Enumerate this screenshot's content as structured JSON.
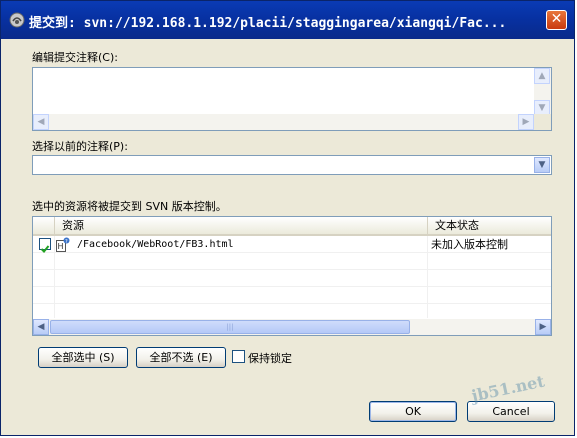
{
  "window": {
    "title": "提交到:  svn://192.168.1.192/placii/staggingarea/xiangqi/Fac...",
    "close_glyph": "✕"
  },
  "message": {
    "label": "编辑提交注释",
    "hotkey": "(C)",
    "label_suffix": ":",
    "value": ""
  },
  "previous": {
    "label": "选择以前的注释",
    "hotkey": "(P)",
    "label_suffix": ":",
    "selected": ""
  },
  "resources": {
    "caption": "选中的资源将被提交到 SVN 版本控制。",
    "columns": [
      "资源",
      "文本状态"
    ],
    "rows": [
      {
        "checked": true,
        "icon": "html-file-icon",
        "path": "/Facebook/WebRoot/FB3.html",
        "status": "未加入版本控制"
      }
    ],
    "scroll_thumb_glyph": "|||"
  },
  "actions": {
    "select_all": "全部选中 (S)",
    "deselect_all": "全部不选 (E)",
    "keep_locks": "保持锁定",
    "keep_locks_checked": false,
    "ok": "OK",
    "cancel": "Cancel"
  },
  "watermark": "jb51.net",
  "colors": {
    "titlebar": "#0a3bb5",
    "dialog_bg": "#ece9d8",
    "field_border": "#7f9db9"
  }
}
